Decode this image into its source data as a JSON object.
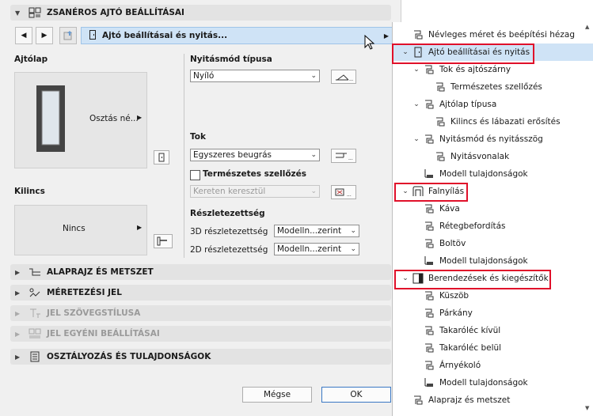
{
  "dialog": {
    "sections": {
      "s1": "ZSANÉROS AJTÓ BEÁLLÍTÁSAI",
      "s2": "ALAPRAJZ ÉS METSZET",
      "s3": "MÉRETEZÉSI JEL",
      "s4": "JEL SZÖVEGSTÍLUSA",
      "s5": "JEL EGYÉNI BEÁLLÍTÁSAI",
      "s6": "OSZTÁLYOZÁS ÉS TULAJDONSÁGOK"
    },
    "nav": {
      "current": "Ajtó beállításai és nyitás..."
    },
    "ajtolap": {
      "label": "Ajtólap",
      "preview_label": "Osztás né..."
    },
    "kilincs": {
      "label": "Kilincs",
      "preview_label": "Nincs"
    },
    "nyitasmod": {
      "label": "Nyitásmód típusa",
      "value": "Nyíló"
    },
    "tok": {
      "label": "Tok",
      "value": "Egyszeres beugrás"
    },
    "szellozes": {
      "label": "Természetes szellőzés",
      "checked": false,
      "value": "Kereten keresztül"
    },
    "reszletezettseg": {
      "label": "Részletezettség",
      "row3d_label": "3D részletezettség",
      "row3d_value": "Modelln...zerint",
      "row2d_label": "2D részletezettség",
      "row2d_value": "Modelln...zerint"
    },
    "buttons": {
      "cancel": "Mégse",
      "ok": "OK"
    }
  },
  "panel": {
    "items": [
      {
        "label": "Névleges méret és beépítési hézag",
        "level": 0,
        "chevron": "",
        "bold": false
      },
      {
        "label": "Ajtó beállításai és nyitás",
        "level": 0,
        "chevron": "v",
        "bold": false
      },
      {
        "label": "Tok és ajtószárny",
        "level": 1,
        "chevron": "v",
        "bold": false
      },
      {
        "label": "Természetes szellőzés",
        "level": 2,
        "chevron": "",
        "bold": false
      },
      {
        "label": "Ajtólap típusa",
        "level": 1,
        "chevron": "v",
        "bold": false
      },
      {
        "label": "Kilincs és lábazati erősítés",
        "level": 2,
        "chevron": "",
        "bold": false
      },
      {
        "label": "Nyitásmód és nyitásszög",
        "level": 1,
        "chevron": "v",
        "bold": false
      },
      {
        "label": "Nyitásvonalak",
        "level": 2,
        "chevron": "",
        "bold": false
      },
      {
        "label": "Modell tulajdonságok",
        "level": 1,
        "chevron": "",
        "bold": false
      },
      {
        "label": "Falnyílás",
        "level": 0,
        "chevron": "v",
        "bold": false
      },
      {
        "label": "Káva",
        "level": 1,
        "chevron": "",
        "bold": false
      },
      {
        "label": "Rétegbefordítás",
        "level": 1,
        "chevron": "",
        "bold": false
      },
      {
        "label": "Boltöv",
        "level": 1,
        "chevron": "",
        "bold": false
      },
      {
        "label": "Modell tulajdonságok",
        "level": 1,
        "chevron": "",
        "bold": false
      },
      {
        "label": "Berendezések és kiegészítők",
        "level": 0,
        "chevron": "v",
        "bold": false
      },
      {
        "label": "Küszöb",
        "level": 1,
        "chevron": "",
        "bold": false
      },
      {
        "label": "Párkány",
        "level": 1,
        "chevron": "",
        "bold": false
      },
      {
        "label": "Takaróléc kívül",
        "level": 1,
        "chevron": "",
        "bold": false
      },
      {
        "label": "Takaróléc belül",
        "level": 1,
        "chevron": "",
        "bold": false
      },
      {
        "label": "Árnyékoló",
        "level": 1,
        "chevron": "",
        "bold": false
      },
      {
        "label": "Modell tulajdonságok",
        "level": 1,
        "chevron": "",
        "bold": false
      },
      {
        "label": "Alaprajz és metszet",
        "level": 0,
        "chevron": "",
        "bold": false
      }
    ]
  },
  "colors": {
    "highlight": "#e0102a",
    "selection": "#cfe3f6"
  }
}
